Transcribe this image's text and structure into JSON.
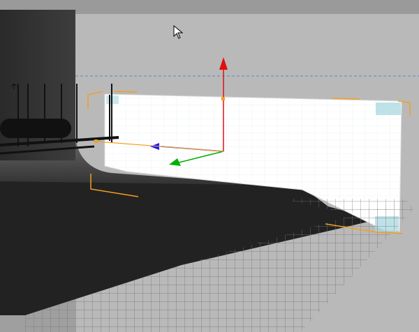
{
  "viewport": {
    "name": "3d-perspective-viewport",
    "background_color": "#9f9f9f",
    "top_band_color": "#9a9a9a",
    "backdrop_color": "#b9b9b9",
    "floor_color": "#222222",
    "wall_color": "#3a3a3a",
    "grid_color": "#7a7a7a",
    "selection_bracket_color": "#f0a020",
    "axis_colors": {
      "x": "#1a1aff",
      "y": "#e01010",
      "z": "#00b000",
      "yellow": "#f0a020"
    },
    "panel_color": "#ffffff",
    "icons": [
      "mouse-pointer-icon",
      "move-gizmo-icon",
      "softbox-light-icon"
    ]
  }
}
